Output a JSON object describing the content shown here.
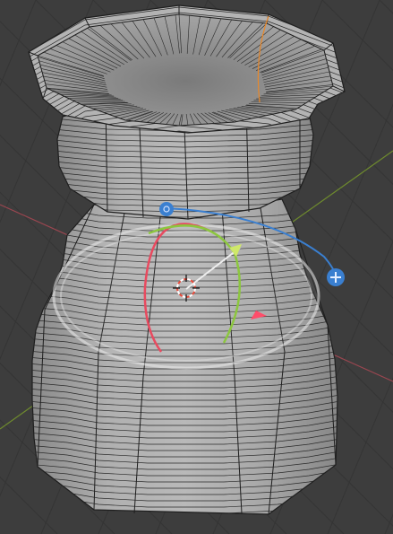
{
  "viewport": {
    "background": "#3d3d3d",
    "grid_color": "#353535",
    "x_axis_color": "#9a4650",
    "y_axis_color": "#6e8a2e"
  },
  "mesh": {
    "object": "vase",
    "sides": 8,
    "shading": "solid",
    "wireframe_overlay": true,
    "face_color": "#a9a9a9",
    "edge_color": "#1e1e1e",
    "selected_edge_color": "#e8882a"
  },
  "gizmo": {
    "type": "rotate",
    "icons": [
      "rotate-ring",
      "trackball",
      "x-rotate-handle",
      "y-rotate-handle",
      "z-rotate-handle",
      "pivot-center-icon",
      "view-rotate-plus-icon",
      "rotate-handle-icon"
    ],
    "x_axis_color": "#e84a5f",
    "y_axis_color": "#8cc63f",
    "z_axis_color": "#3a7fd0",
    "ring_color": "#e6e6e6"
  },
  "cursor_3d": {
    "icon": "3d-cursor-icon",
    "colors": [
      "#e84a3a",
      "#ffffff"
    ]
  }
}
